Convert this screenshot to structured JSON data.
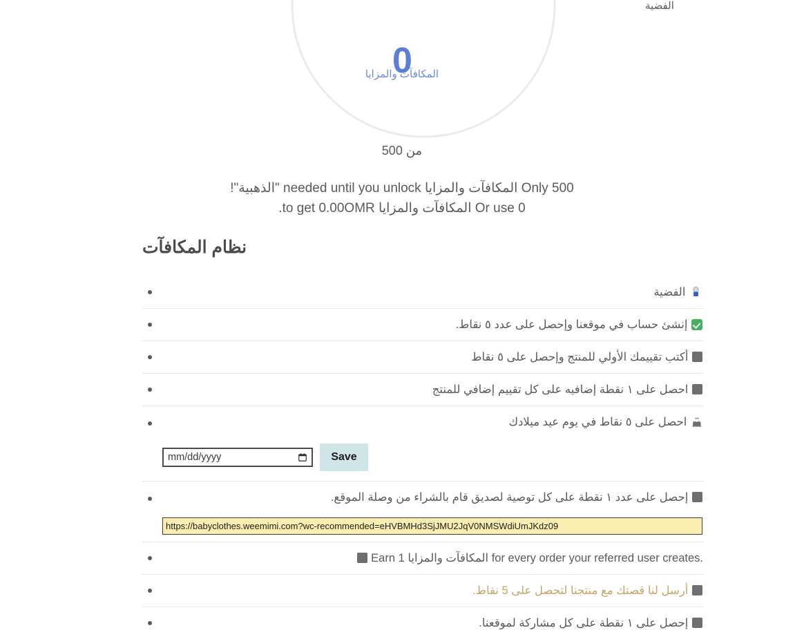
{
  "tier": {
    "current_label": "الفضية"
  },
  "gauge": {
    "value": "0",
    "points_label": "المكافآت والمزايا",
    "out_of": "من 500",
    "max": 500,
    "value_color": "#5b7fd4",
    "track_color": "#ebebeb"
  },
  "unlock": {
    "line1": "Only 500 المكافآت والمزايا needed until you unlock \"الذهبية\"!",
    "line2": "Or use 0 المكافآت والمزايا to get 0.00OMR."
  },
  "section": {
    "heading": "نظام المكافآت"
  },
  "rewards": [
    {
      "icon": "silver-trophy-emoji",
      "text": "الفضية"
    },
    {
      "icon": "green-check-emoji",
      "text": "إنشئ حساب في موقعنا وإحصل على عدد ٥ نقاط."
    },
    {
      "icon": "missing-glyph-box",
      "text": "أكتب تقييمك الأولي للمنتج وإحصل على ٥ نقاط"
    },
    {
      "icon": "missing-glyph-box",
      "text": "احصل على ١ نقطة إضافيه على كل تقييم إضافي للمنتج"
    },
    {
      "icon": "birthday-cake-emoji",
      "text": "احصل على ٥ نقاط في يوم عيد ميلادك"
    },
    {
      "icon": "missing-glyph-box",
      "text": "إحصل على عدد ١ نقطة على كل توصية لصديق قام بالشراء من وصلة الموقع."
    },
    {
      "icon": "missing-glyph-box",
      "text": "Earn 1 المكافآت والمزايا for every order your referred user creates."
    },
    {
      "icon": "missing-glyph-box",
      "text": "أرسل لنا قصتك مع منتجنا لتحصل على 5 نقاط.",
      "is_link": true,
      "link_color": "#c7a468"
    },
    {
      "icon": "missing-glyph-box",
      "text": "إحصل على ١ نقطة على كل مشاركة لموقعنا."
    }
  ],
  "birthday_form": {
    "date_placeholder": "mm/dd/yyyy",
    "date_value": "",
    "save_label": "Save",
    "save_bg": "#cfe5e7"
  },
  "referral": {
    "url": "https://babyclothes.weemimi.com?wc-recommended=eHVBMHd3SjJMU2JqV0NMSWdiUmJKdz09",
    "field_bg": "#faedaf"
  }
}
